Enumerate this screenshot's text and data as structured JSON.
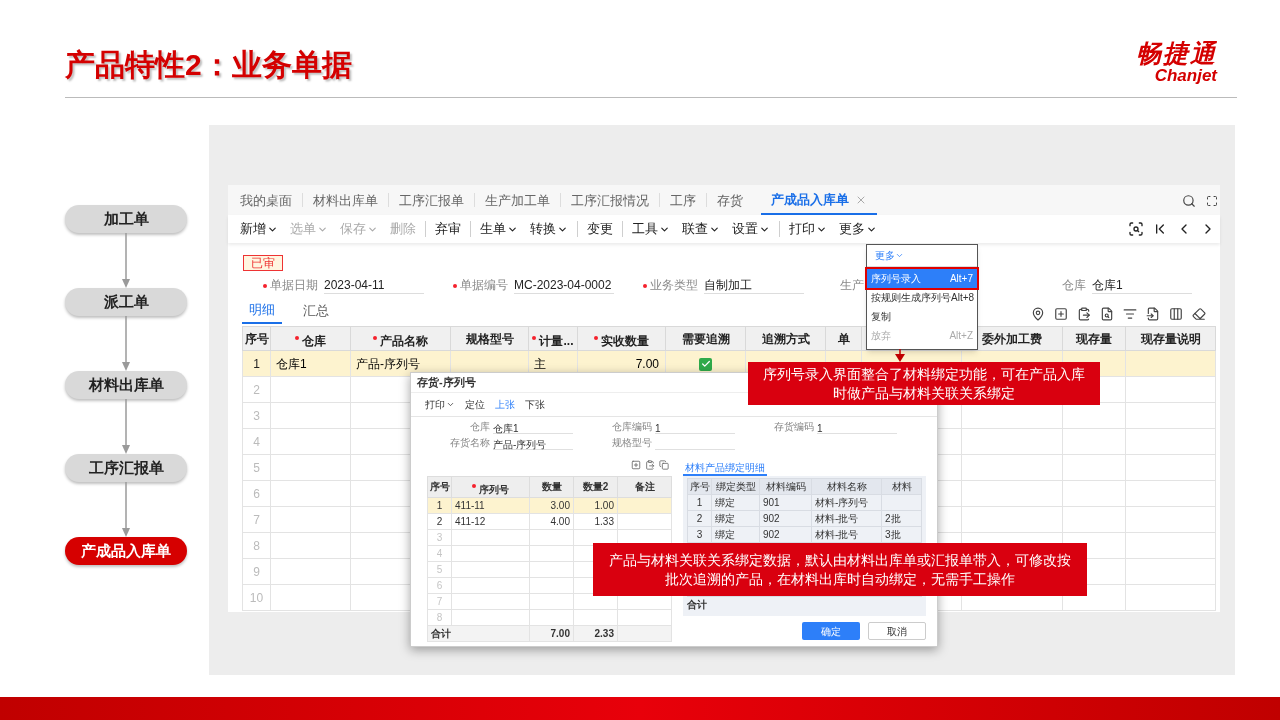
{
  "slide": {
    "title": "产品特性2：业务单据",
    "logo_text": "畅捷通",
    "logo_subtext": "Chanjet"
  },
  "flow": [
    {
      "label": "加工单",
      "selected": false
    },
    {
      "label": "派工单",
      "selected": false
    },
    {
      "label": "材料出库单",
      "selected": false
    },
    {
      "label": "工序汇报单",
      "selected": false
    },
    {
      "label": "产成品入库单",
      "selected": true
    }
  ],
  "app": {
    "tabs": [
      {
        "label": "我的桌面",
        "selected": false,
        "closable": false
      },
      {
        "label": "材料出库单",
        "selected": false,
        "closable": false
      },
      {
        "label": "工序汇报单",
        "selected": false,
        "closable": false
      },
      {
        "label": "生产加工单",
        "selected": false,
        "closable": false
      },
      {
        "label": "工序汇报情况",
        "selected": false,
        "closable": false
      },
      {
        "label": "工序",
        "selected": false,
        "closable": false
      },
      {
        "label": "存货",
        "selected": false,
        "closable": false
      },
      {
        "label": "产成品入库单",
        "selected": true,
        "closable": true
      }
    ],
    "toolbar": [
      {
        "label": "新增",
        "dropdown": true,
        "disabled": false,
        "separator_after": false
      },
      {
        "label": "选单",
        "dropdown": true,
        "disabled": true,
        "separator_after": false
      },
      {
        "label": "保存",
        "dropdown": true,
        "disabled": true,
        "separator_after": false
      },
      {
        "label": "删除",
        "dropdown": false,
        "disabled": true,
        "separator_after": true
      },
      {
        "label": "弃审",
        "dropdown": false,
        "disabled": false,
        "separator_after": true
      },
      {
        "label": "生单",
        "dropdown": true,
        "disabled": false,
        "separator_after": false
      },
      {
        "label": "转换",
        "dropdown": true,
        "disabled": false,
        "separator_after": true
      },
      {
        "label": "变更",
        "dropdown": false,
        "disabled": false,
        "separator_after": true
      },
      {
        "label": "工具",
        "dropdown": true,
        "disabled": false,
        "separator_after": false
      },
      {
        "label": "联查",
        "dropdown": true,
        "disabled": false,
        "separator_after": false
      },
      {
        "label": "设置",
        "dropdown": true,
        "disabled": false,
        "separator_after": true
      },
      {
        "label": "打印",
        "dropdown": true,
        "disabled": false,
        "separator_after": false
      },
      {
        "label": "更多",
        "dropdown": true,
        "disabled": false,
        "separator_after": false
      }
    ],
    "status_badge": "已审",
    "fields": [
      {
        "label": "单据日期",
        "value": "2023-04-11",
        "required": true
      },
      {
        "label": "单据编号",
        "value": "MC-2023-04-0002",
        "required": true
      },
      {
        "label": "业务类型",
        "value": "自制加工",
        "required": true
      },
      {
        "label": "生产",
        "required": false
      },
      {
        "label": "仓库",
        "value": "仓库1",
        "required": false
      }
    ],
    "sub_tabs": [
      {
        "label": "明细",
        "selected": true
      },
      {
        "label": "汇总",
        "selected": false
      }
    ],
    "table": {
      "columns": [
        {
          "label": "序号",
          "required": false
        },
        {
          "label": "仓库",
          "required": true
        },
        {
          "label": "产品名称",
          "required": true
        },
        {
          "label": "规格型号",
          "required": false
        },
        {
          "label": "计量...",
          "required": true
        },
        {
          "label": "实收数量",
          "required": true
        },
        {
          "label": "需要追溯",
          "required": false
        },
        {
          "label": "追溯方式",
          "required": false
        },
        {
          "label": "单",
          "required": false
        },
        {},
        {
          "label": "委外加工费",
          "required": false
        },
        {
          "label": "现存量",
          "required": false
        },
        {
          "label": "现存量说明",
          "required": false
        }
      ],
      "rows": [
        {
          "no": "1",
          "selected": true,
          "warehouse": "仓库1",
          "product": "产品-序列号",
          "unit": "主",
          "qty": "7.00",
          "trace_needed": true
        },
        {
          "no": "2",
          "selected": false
        },
        {
          "no": "3",
          "selected": false
        },
        {
          "no": "4",
          "selected": false
        },
        {
          "no": "5",
          "selected": false
        },
        {
          "no": "6",
          "selected": false
        },
        {
          "no": "7",
          "selected": false
        },
        {
          "no": "8",
          "selected": false
        },
        {
          "no": "9",
          "selected": false
        },
        {
          "no": "10",
          "selected": false
        }
      ]
    }
  },
  "more_menu": {
    "title": "更多",
    "items": [
      {
        "label": "序列号录入",
        "shortcut": "Alt+7",
        "selected": true,
        "disabled": false
      },
      {
        "label": "按规则生成序列号",
        "shortcut": "Alt+8",
        "selected": false,
        "disabled": false
      },
      {
        "label": "复制",
        "selected": false,
        "disabled": false
      },
      {
        "label": "放弃",
        "shortcut": "Alt+Z",
        "selected": false,
        "disabled": true
      }
    ]
  },
  "dialog": {
    "title": "存货-序列号",
    "toolbar": [
      {
        "label": "打印",
        "dropdown": true,
        "selected": false
      },
      {
        "label": "定位",
        "dropdown": false,
        "selected": false
      },
      {
        "label": "上张",
        "dropdown": false,
        "selected": true
      },
      {
        "label": "下张",
        "dropdown": false,
        "selected": false
      }
    ],
    "fields": [
      {
        "label": "仓库",
        "value": "仓库1"
      },
      {
        "label": "仓库编码",
        "value": "1"
      },
      {
        "label": "存货编码",
        "value": "1"
      },
      {
        "label": "存货名称",
        "value": "产品-序列号"
      },
      {
        "label": "规格型号"
      }
    ],
    "serial_table": {
      "columns": [
        {
          "label": "序号",
          "required": false
        },
        {
          "label": "序列号",
          "required": true
        },
        {
          "label": "数量",
          "required": false
        },
        {
          "label": "数量2",
          "required": false
        },
        {
          "label": "备注",
          "required": false
        }
      ],
      "rows": [
        {
          "no": "1",
          "serial": "411-11",
          "qty": "3.00",
          "qty2": "1.00",
          "selected": true
        },
        {
          "no": "2",
          "serial": "411-12",
          "qty": "4.00",
          "qty2": "1.33",
          "selected": false
        },
        {
          "no": "3",
          "selected": false
        },
        {
          "no": "4",
          "selected": false
        },
        {
          "no": "5",
          "selected": false
        },
        {
          "no": "6",
          "selected": false
        },
        {
          "no": "7",
          "selected": false
        },
        {
          "no": "8",
          "selected": false
        }
      ],
      "total": {
        "label": "合计",
        "qty": "7.00",
        "qty2": "2.33"
      }
    },
    "binding_panel": {
      "tab": "材料产品绑定明细",
      "columns": [
        "序号",
        "绑定类型",
        "材料编码",
        "材料名称",
        "材料"
      ],
      "rows": [
        {
          "no": "1",
          "type": "绑定",
          "code": "901",
          "name": "材料-序列号"
        },
        {
          "no": "2",
          "type": "绑定",
          "code": "902",
          "name": "材料-批号",
          "batch": "2批"
        },
        {
          "no": "3",
          "type": "绑定",
          "code": "902",
          "name": "材料-批号",
          "batch": "3批"
        }
      ],
      "total_label": "合计"
    },
    "buttons": [
      {
        "label": "确定",
        "primary": true
      },
      {
        "label": "取消",
        "primary": false
      }
    ]
  },
  "callouts": [
    {
      "text": "序列号录入界面整合了材料绑定功能，可在产品入库时做产品与材料关联关系绑定"
    },
    {
      "text": "产品与材料关联关系绑定数据，默认由材料出库单或汇报单带入，可修改按批次追溯的产品，在材料出库时自动绑定，无需手工操作"
    }
  ]
}
